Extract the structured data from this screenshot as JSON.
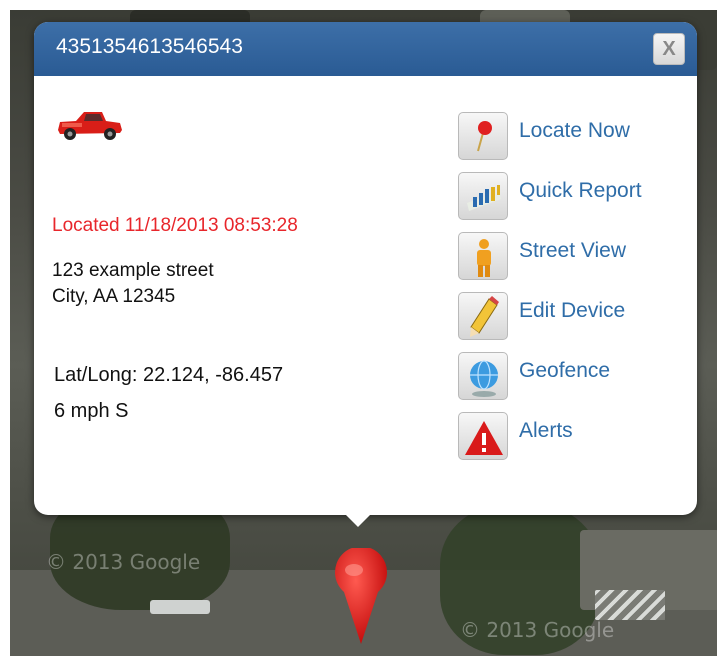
{
  "popup": {
    "title": "4351354613546543",
    "close_label": "X",
    "located": "Located 11/18/2013 08:53:28",
    "address_line1": "123 example street",
    "address_line2": "City, AA 12345",
    "latlong_label": "Lat/Long:",
    "latlong_value": "22.124, -86.457",
    "speed": "6 mph S"
  },
  "actions": [
    {
      "label": "Locate Now",
      "icon": "map-pin-icon"
    },
    {
      "label": "Quick Report",
      "icon": "report-chart-icon"
    },
    {
      "label": "Street View",
      "icon": "person-icon"
    },
    {
      "label": "Edit Device",
      "icon": "pencil-icon"
    },
    {
      "label": "Geofence",
      "icon": "globe-icon"
    },
    {
      "label": "Alerts",
      "icon": "warning-icon"
    }
  ],
  "map": {
    "watermark": "© 2013 Google"
  },
  "colors": {
    "header": "#2a5b94",
    "located_text": "#e8262b",
    "link": "#2f6da8",
    "pin": "#e01b1b"
  }
}
